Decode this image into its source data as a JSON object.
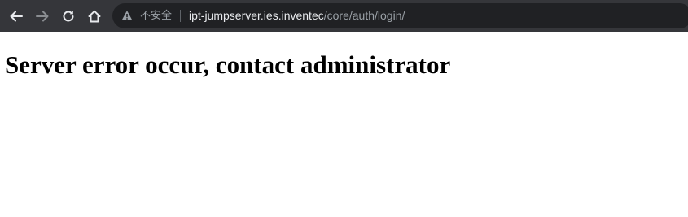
{
  "browser": {
    "nav": {
      "back_icon": "arrow-left-icon",
      "forward_icon": "arrow-right-icon",
      "reload_icon": "reload-icon",
      "home_icon": "home-icon"
    },
    "omnibox": {
      "security_icon": "warning-triangle-icon",
      "security_label": "不安全",
      "url_host": "ipt-jumpserver.ies.inventec",
      "url_path": "/core/auth/login/"
    },
    "colors": {
      "toolbar_bg": "#35363a",
      "omnibox_bg": "#202124",
      "host_text": "#e8eaed",
      "dim_text": "#9aa0a6"
    }
  },
  "page": {
    "heading": "Server error occur, contact administrator"
  }
}
